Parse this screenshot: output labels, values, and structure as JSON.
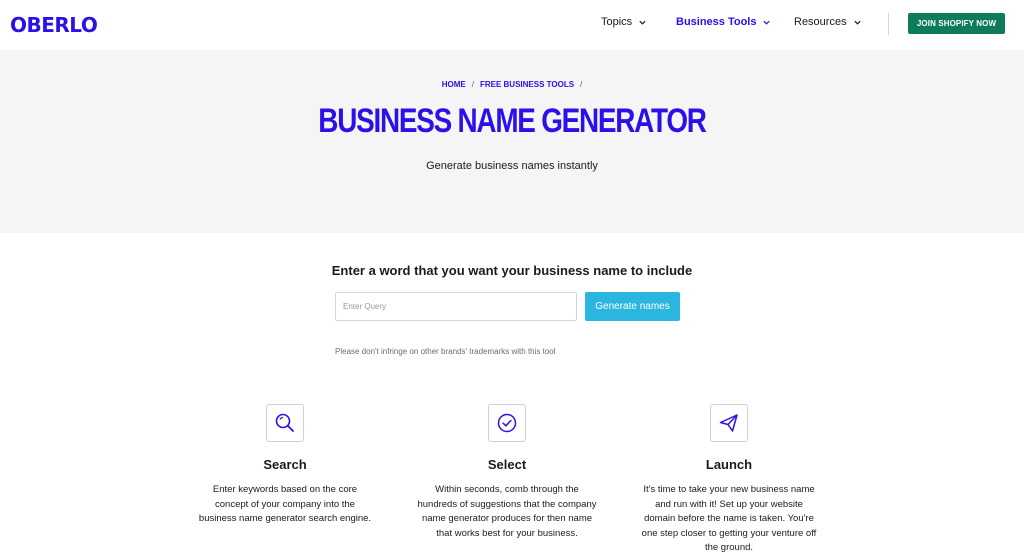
{
  "header": {
    "logo": "OBERLO",
    "nav": [
      {
        "label": "Topics",
        "active": false
      },
      {
        "label": "Business Tools",
        "active": true
      },
      {
        "label": "Resources",
        "active": false
      }
    ],
    "cta_label": "JOIN SHOPIFY NOW"
  },
  "hero": {
    "breadcrumb": [
      "HOME",
      "FREE BUSINESS TOOLS"
    ],
    "title": "BUSINESS NAME GENERATOR",
    "subtitle": "Generate business names instantly"
  },
  "query": {
    "heading": "Enter a word that you want your business name to include",
    "placeholder": "Enter Query",
    "value": "",
    "button_label": "Generate names",
    "disclaimer": "Please don't infringe on other brands' trademarks with this tool"
  },
  "features": [
    {
      "icon": "search-icon",
      "title": "Search",
      "description": "Enter keywords based on the core concept of your company into the business name generator search engine."
    },
    {
      "icon": "check-circle-icon",
      "title": "Select",
      "description": "Within seconds, comb through the hundreds of suggestions that the company name generator produces for then name that works best for your business."
    },
    {
      "icon": "paper-plane-icon",
      "title": "Launch",
      "description": "It's time to take your new business name and run with it! Set up your website domain before the name is taken. You're one step closer to getting your venture off the ground."
    }
  ],
  "colors": {
    "brand": "#2c10e8",
    "cta": "#0e7c5a",
    "button": "#2bb6e0",
    "hero_bg": "#f5f5f6"
  }
}
